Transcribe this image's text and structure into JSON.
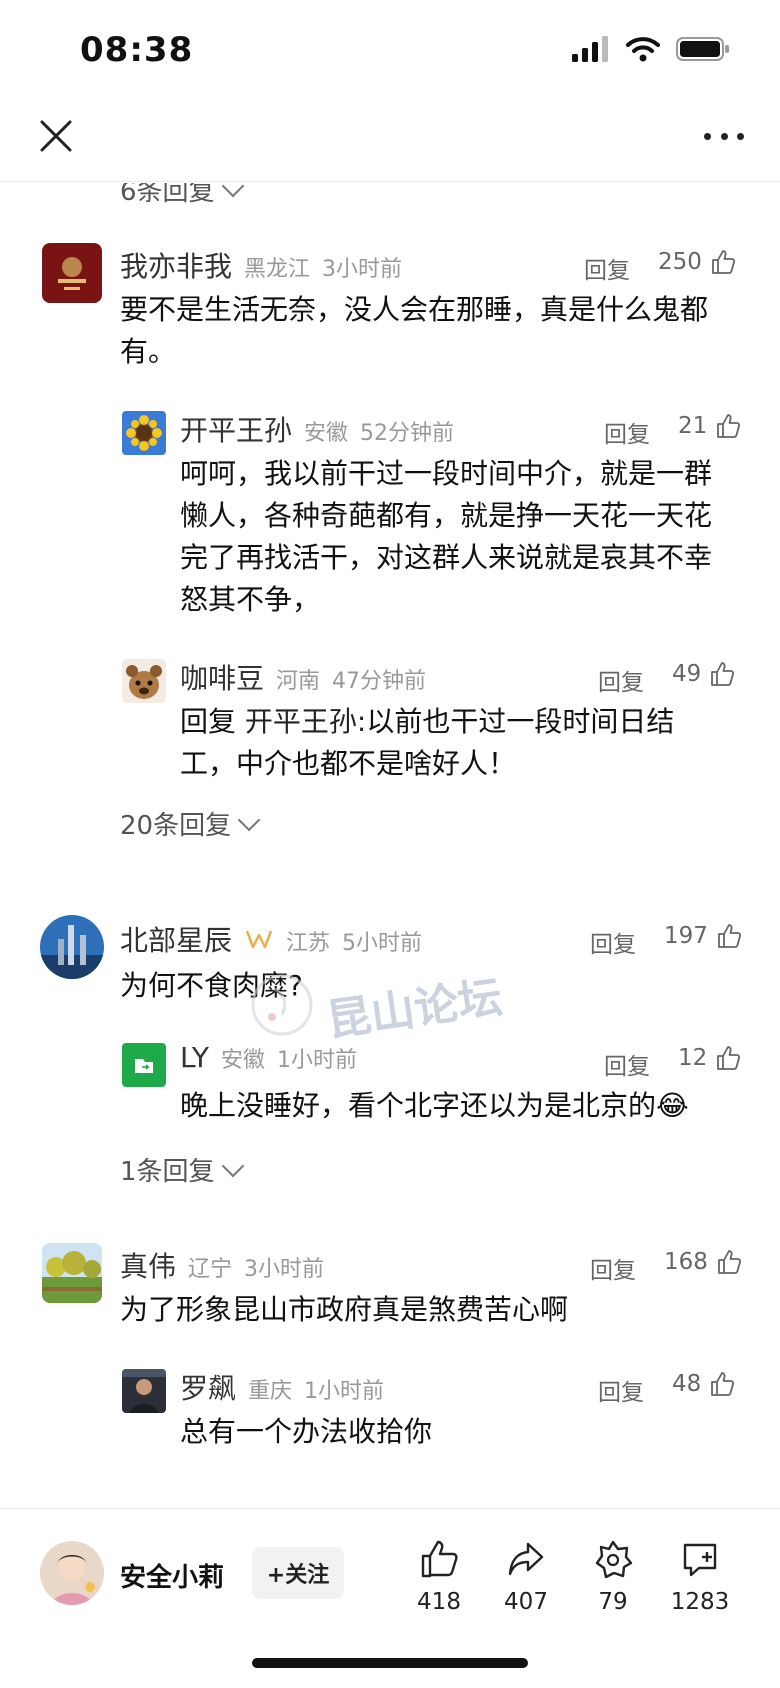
{
  "status": {
    "time": "08:38"
  },
  "top_collapsed": {
    "label": "6条回复"
  },
  "comments": [
    {
      "name": "我亦非我",
      "location": "黑龙江",
      "time": "3小时前",
      "reply": "回复",
      "likes": "250",
      "text": "要不是生活无奈，没人会在那睡，真是什么鬼都有。",
      "replies": [
        {
          "name": "开平王孙",
          "location": "安徽",
          "time": "52分钟前",
          "reply": "回复",
          "likes": "21",
          "text": "呵呵，我以前干过一段时间中介，就是一群懒人，各种奇葩都有，就是挣一天花一天花完了再找活干，对这群人来说就是哀其不幸怒其不争，"
        },
        {
          "name": "咖啡豆",
          "location": "河南",
          "time": "47分钟前",
          "reply": "回复",
          "likes": "49",
          "prefix": "回复",
          "ref": "开平王孙:",
          "text": "以前也干过一段时间日结工，中介也都不是啥好人！"
        }
      ],
      "more": "20条回复"
    },
    {
      "name": "北部星辰",
      "location": "江苏",
      "time": "5小时前",
      "reply": "回复",
      "likes": "197",
      "text": "为何不食肉糜?",
      "replies": [
        {
          "name": "LY",
          "location": "安徽",
          "time": "1小时前",
          "reply": "回复",
          "likes": "12",
          "text": "晚上没睡好，看个北字还以为是北京的😂"
        }
      ],
      "more": "1条回复"
    },
    {
      "name": "真伟",
      "location": "辽宁",
      "time": "3小时前",
      "reply": "回复",
      "likes": "168",
      "text": "为了形象昆山市政府真是煞费苦心啊",
      "replies": [
        {
          "name": "罗飙",
          "location": "重庆",
          "time": "1小时前",
          "reply": "回复",
          "likes": "48",
          "text": "总有一个办法收拾你"
        }
      ]
    }
  ],
  "watermark": "昆山论坛",
  "bottom": {
    "author": "安全小莉",
    "follow": "+关注",
    "likes": "418",
    "shares": "407",
    "favorites": "79",
    "comments": "1283"
  }
}
